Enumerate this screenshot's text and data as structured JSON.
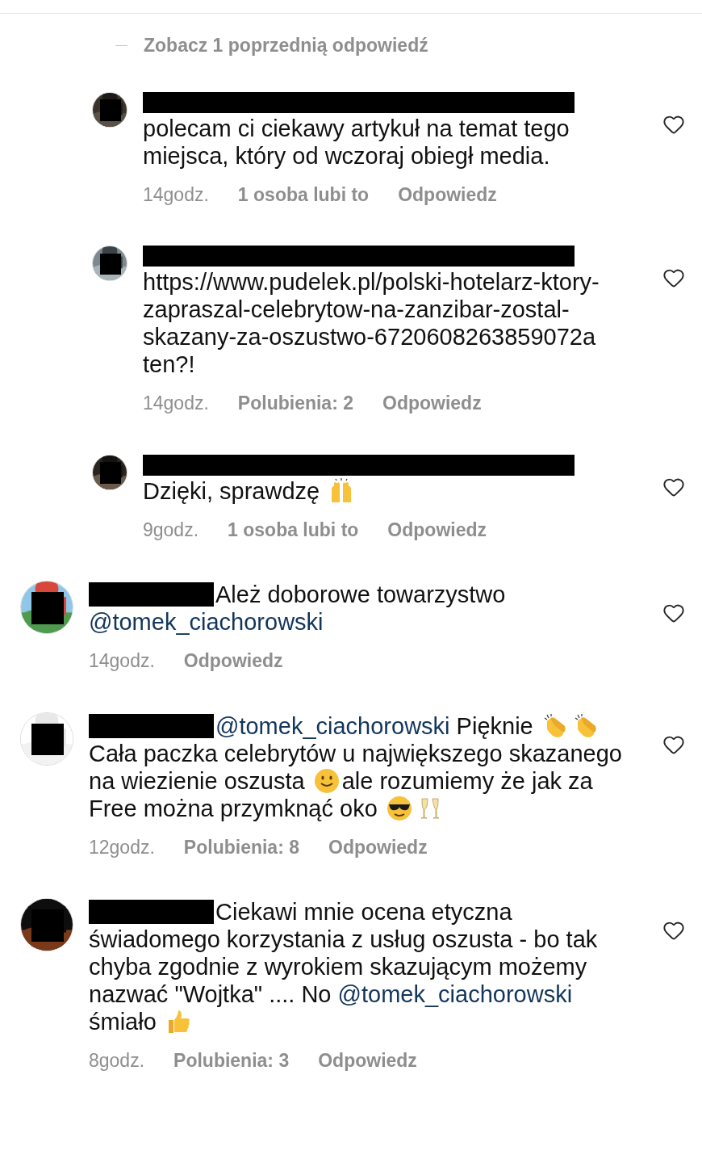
{
  "header": {
    "view_previous": "Zobacz 1 poprzednią odpowiedź"
  },
  "comments": [
    {
      "kind": "reply",
      "author_redacted": true,
      "liked": false,
      "body": [
        {
          "kind": "text",
          "text": "polecam ci ciekawy artykuł na temat tego miejsca, który od wczoraj obiegł media."
        }
      ],
      "time": "14godz.",
      "likes": "1 osoba lubi to",
      "reply": "Odpowiedz"
    },
    {
      "kind": "reply",
      "author_redacted": true,
      "liked": false,
      "body": [
        {
          "kind": "text",
          "text": "https://www.pudelek.pl/polski-hotelarz-ktory-zapraszal-celebrytow-na-zanzibar-zostal-skazany-za-oszustwo-6720608263859072a ten?!"
        }
      ],
      "time": "14godz.",
      "likes": "Polubienia: 2",
      "reply": "Odpowiedz"
    },
    {
      "kind": "reply",
      "author_redacted": true,
      "liked": false,
      "body": [
        {
          "kind": "text",
          "text": "Dzięki, sprawdzę "
        },
        {
          "kind": "raisedhands"
        }
      ],
      "time": "9godz.",
      "likes": "1 osoba lubi to",
      "reply": "Odpowiedz"
    },
    {
      "kind": "top",
      "author_redacted": true,
      "liked": false,
      "body": [
        {
          "kind": "text",
          "text": "Ależ doborowe towarzystwo "
        },
        {
          "kind": "mention",
          "text": "@tomek_ciachorowski"
        }
      ],
      "time": "14godz.",
      "reply": "Odpowiedz"
    },
    {
      "kind": "top",
      "author_redacted": true,
      "liked": false,
      "body": [
        {
          "kind": "mention",
          "text": "@tomek_ciachorowski"
        },
        {
          "kind": "text",
          "text": " Pięknie "
        },
        {
          "kind": "clap"
        },
        {
          "kind": "clap"
        },
        {
          "kind": "text",
          "text": "Cała paczka celebrytów u największego skazanego na wiezienie oszusta "
        },
        {
          "kind": "smile"
        },
        {
          "kind": "text",
          "text": "ale rozumiemy że jak za Free można przymknąć oko "
        },
        {
          "kind": "cool"
        },
        {
          "kind": "cheers"
        }
      ],
      "time": "12godz.",
      "likes": "Polubienia: 8",
      "reply": "Odpowiedz"
    },
    {
      "kind": "top",
      "author_redacted": true,
      "liked": false,
      "body": [
        {
          "kind": "text",
          "text": "Ciekawi mnie ocena etyczna świadomego korzystania z usług oszusta - bo tak chyba zgodnie z wyrokiem skazującym możemy nazwać \"Wojtka\" .... No "
        },
        {
          "kind": "mention",
          "text": "@tomek_ciachorowski"
        },
        {
          "kind": "text",
          "text": " śmiało "
        },
        {
          "kind": "thumbsup"
        }
      ],
      "time": "8godz.",
      "likes": "Polubienia: 3",
      "reply": "Odpowiedz"
    }
  ]
}
